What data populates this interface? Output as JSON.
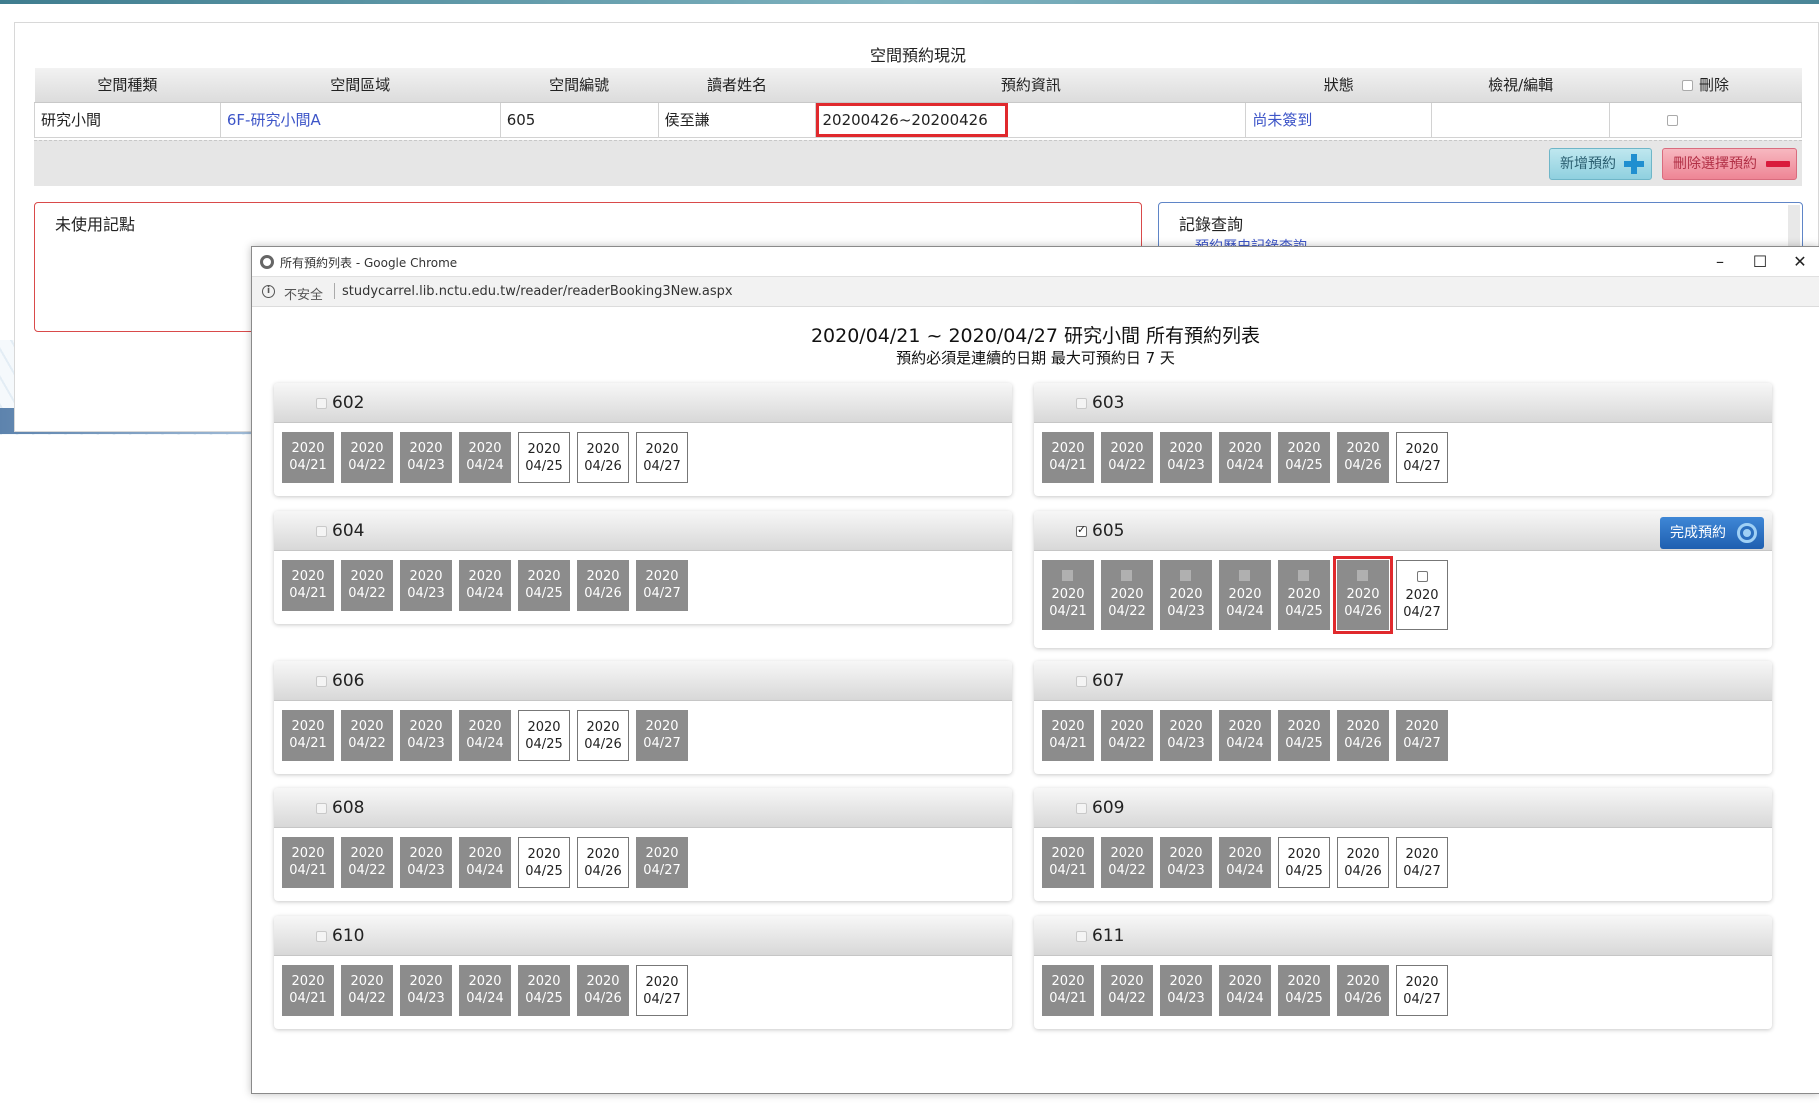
{
  "reservation": {
    "title": "空間預約現況",
    "headers": {
      "type": "空間種類",
      "area": "空間區域",
      "number": "空間編號",
      "reader": "讀者姓名",
      "info": "預約資訊",
      "status": "狀態",
      "view": "檢視/編輯",
      "delete": "刪除"
    },
    "row": {
      "type": "研究小間",
      "area": "6F-研究小間A",
      "number": "605",
      "reader": "侯至謙",
      "info": "20200426~20200426",
      "status": "尚未簽到"
    },
    "add_button": "新增預約",
    "delete_button": "刪除選擇預約"
  },
  "unused_points": {
    "title": "未使用記點"
  },
  "records": {
    "title": "記錄查詢",
    "link": "預約歷史記錄查詢"
  },
  "popup": {
    "window_title": "所有預約列表 - Google Chrome",
    "insecure": "不安全",
    "url": "studycarrel.lib.nctu.edu.tw/reader/readerBooking3New.aspx",
    "page_title": "2020/04/21 ~ 2020/04/27 研究小間 所有預約列表",
    "subtitle": "預約必須是連續的日期 最大可預約日 7 天",
    "complete_button": "完成預約",
    "year": "2020",
    "dates": [
      "04/21",
      "04/22",
      "04/23",
      "04/24",
      "04/25",
      "04/26",
      "04/27"
    ],
    "rooms": [
      {
        "name": "602",
        "checked": false,
        "status": [
          "taken",
          "taken",
          "taken",
          "taken",
          "free",
          "free",
          "free"
        ]
      },
      {
        "name": "603",
        "checked": false,
        "status": [
          "taken",
          "taken",
          "taken",
          "taken",
          "taken",
          "taken",
          "free"
        ]
      },
      {
        "name": "604",
        "checked": false,
        "status": [
          "taken",
          "taken",
          "taken",
          "taken",
          "taken",
          "taken",
          "taken"
        ]
      },
      {
        "name": "605",
        "checked": true,
        "status": [
          "taken",
          "taken",
          "taken",
          "taken",
          "taken",
          "taken",
          "free"
        ]
      },
      {
        "name": "606",
        "checked": false,
        "status": [
          "taken",
          "taken",
          "taken",
          "taken",
          "free",
          "free",
          "taken"
        ]
      },
      {
        "name": "607",
        "checked": false,
        "status": [
          "taken",
          "taken",
          "taken",
          "taken",
          "taken",
          "taken",
          "taken"
        ]
      },
      {
        "name": "608",
        "checked": false,
        "status": [
          "taken",
          "taken",
          "taken",
          "taken",
          "free",
          "free",
          "taken"
        ]
      },
      {
        "name": "609",
        "checked": false,
        "status": [
          "taken",
          "taken",
          "taken",
          "taken",
          "free",
          "free",
          "free"
        ]
      },
      {
        "name": "610",
        "checked": false,
        "status": [
          "taken",
          "taken",
          "taken",
          "taken",
          "taken",
          "taken",
          "free"
        ]
      },
      {
        "name": "611",
        "checked": false,
        "status": [
          "taken",
          "taken",
          "taken",
          "taken",
          "taken",
          "taken",
          "free"
        ]
      }
    ]
  }
}
